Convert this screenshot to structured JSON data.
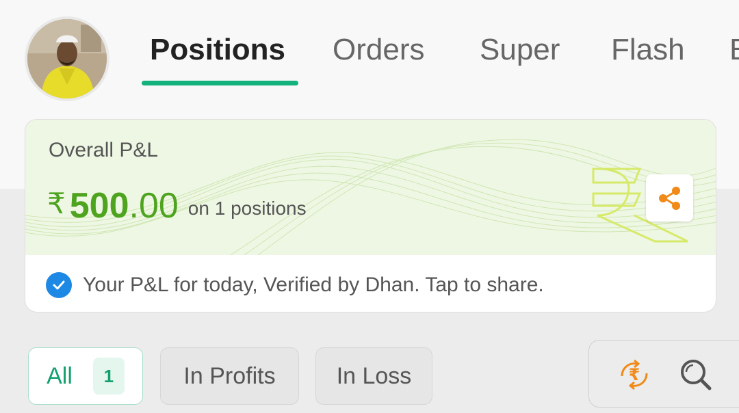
{
  "header": {
    "tabs": [
      {
        "label": "Positions",
        "active": true
      },
      {
        "label": "Orders",
        "active": false
      },
      {
        "label": "Super",
        "active": false
      },
      {
        "label": "Flash",
        "active": false
      },
      {
        "label": "B",
        "active": false
      }
    ],
    "accent_color": "#13b27c"
  },
  "pnl_card": {
    "title": "Overall P&L",
    "currency_symbol": "₹",
    "amount_integer": "500",
    "amount_decimal": ".00",
    "subtitle": "on 1 positions",
    "amount_color": "#4ea31f",
    "share_icon": "share-icon",
    "verified_text": "Your P&L for today, Verified by Dhan. Tap to share.",
    "verified_icon": "check-circle-icon"
  },
  "filters": [
    {
      "label": "All",
      "count": "1",
      "active": true
    },
    {
      "label": "In Profits",
      "active": false
    },
    {
      "label": "In Loss",
      "active": false
    }
  ],
  "tools": {
    "convert_icon": "rupee-convert-icon",
    "search_icon": "search-icon"
  }
}
